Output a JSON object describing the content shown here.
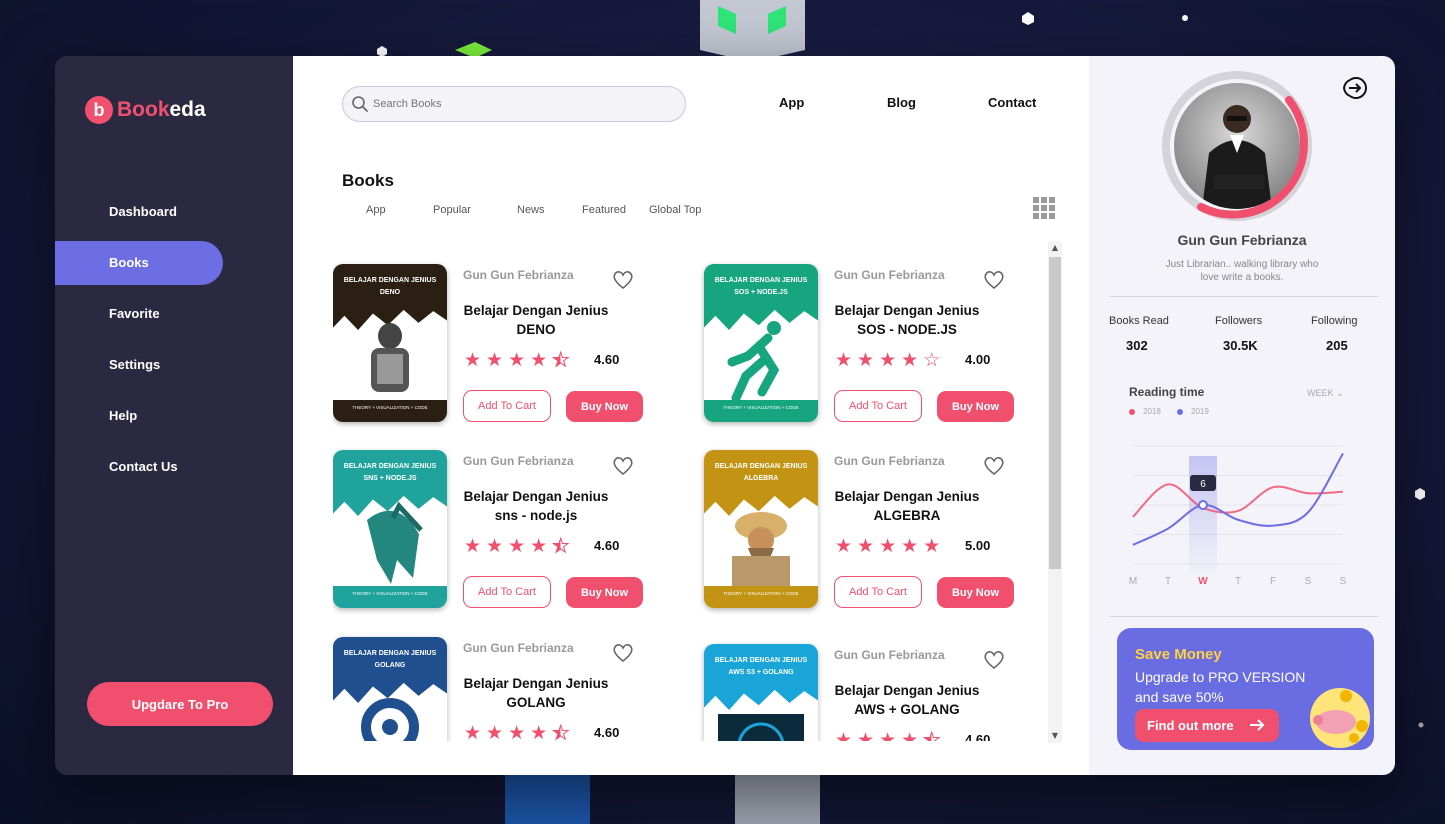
{
  "app": {
    "logo_letter": "b",
    "logo_part1": "Book",
    "logo_part2": "eda"
  },
  "sidebar": {
    "items": [
      {
        "label": "Dashboard"
      },
      {
        "label": "Books"
      },
      {
        "label": "Favorite"
      },
      {
        "label": "Settings"
      },
      {
        "label": "Help"
      },
      {
        "label": "Contact Us"
      }
    ],
    "active_index": 1,
    "upgrade_label": "Upgdare To Pro"
  },
  "header": {
    "search_placeholder": "Search Books",
    "nav": [
      "App",
      "Blog",
      "Contact"
    ]
  },
  "books_section": {
    "title": "Books",
    "tabs": [
      "App",
      "Popular",
      "News",
      "Featured",
      "Global Top"
    ]
  },
  "books": [
    {
      "author": "Gun Gun Febrianza",
      "title_line1": "Belajar Dengan Jenius",
      "title_line2": "DENO",
      "rating": "4.60",
      "stars": 4.5,
      "cover_title": "BELAJAR DENGAN JENIUS",
      "cover_sub": "DENO",
      "cover_color": "#2b1e13",
      "cover_foot": "THEORY + VISUALIZATION + CODE",
      "art": "warrior-icon"
    },
    {
      "author": "Gun Gun Febrianza",
      "title_line1": "Belajar Dengan Jenius",
      "title_line2": "SOS - NODE.JS",
      "rating": "4.00",
      "stars": 4,
      "cover_title": "BELAJAR DENGAN JENIUS",
      "cover_sub": "SOS + NODE.JS",
      "cover_color": "#17a57f",
      "cover_foot": "THEORY + VISUALIZATION + CODE",
      "art": "runner-icon"
    },
    {
      "author": "Gun Gun Febrianza",
      "title_line1": "Belajar Dengan Jenius",
      "title_line2": "sns - node.js",
      "rating": "4.60",
      "stars": 4.5,
      "cover_title": "BELAJAR DENGAN JENIUS",
      "cover_sub": "SNS + NODE.JS",
      "cover_color": "#1fa39c",
      "cover_foot": "THEORY + VISUALIZATION + CODE",
      "art": "helmet-icon"
    },
    {
      "author": "Gun Gun Febrianza",
      "title_line1": "Belajar Dengan Jenius",
      "title_line2": "ALGEBRA",
      "rating": "5.00",
      "stars": 5,
      "cover_title": "BELAJAR DENGAN JENIUS",
      "cover_sub": "ALGEBRA",
      "cover_color": "#c39413",
      "cover_foot": "THEORY + VISUALIZATION + CODE",
      "art": "scholar-icon"
    },
    {
      "author": "Gun Gun Febrianza",
      "title_line1": "Belajar Dengan Jenius",
      "title_line2": "GOLANG",
      "rating": "4.60",
      "stars": 4.5,
      "cover_title": "BELAJAR DENGAN JENIUS",
      "cover_sub": "GOLANG",
      "cover_color": "#1f4f8f",
      "cover_foot": "",
      "art": "gear-icon"
    },
    {
      "author": "Gun Gun Febrianza",
      "title_line1": "Belajar Dengan Jenius",
      "title_line2": "AWS + GOLANG",
      "rating": "4.60",
      "stars": 4.5,
      "cover_title": "BELAJAR DENGAN JENIUS",
      "cover_sub": "AWS S3 + GOLANG",
      "cover_color": "#1aa5d9",
      "cover_foot": "",
      "art": "cloud-icon"
    }
  ],
  "book_buttons": {
    "cart": "Add To Cart",
    "buy": "Buy Now"
  },
  "profile": {
    "name": "Gun Gun Febrianza",
    "bio": "Just Librarian.. walking library who love write a books.",
    "stats": [
      {
        "label": "Books Read",
        "value": "302"
      },
      {
        "label": "Followers",
        "value": "30.5K"
      },
      {
        "label": "Following",
        "value": "205"
      }
    ]
  },
  "reading_time": {
    "title": "Reading time",
    "period": "WEEK",
    "tooltip": "6",
    "active_day_index": 2
  },
  "chart_data": {
    "type": "line",
    "categories": [
      "M",
      "T",
      "W",
      "T",
      "F",
      "S",
      "S"
    ],
    "series": [
      {
        "name": "2018",
        "color": "#f0506e",
        "values": [
          5.2,
          7.4,
          5.8,
          5.6,
          7.2,
          6.8,
          6.9
        ]
      },
      {
        "name": "2019",
        "color": "#6d6ee3",
        "values": [
          3.3,
          4.4,
          6.0,
          5.0,
          4.6,
          5.5,
          9.5
        ]
      }
    ],
    "ylim": [
      2,
      10
    ],
    "grid": true
  },
  "promo": {
    "title": "Save Money",
    "text": "Upgrade to PRO VERSION and save 50%",
    "button": "Find out more"
  },
  "colors": {
    "accent": "#f0506e",
    "primary": "#6d6ee3",
    "sidebar": "#2b2942"
  }
}
